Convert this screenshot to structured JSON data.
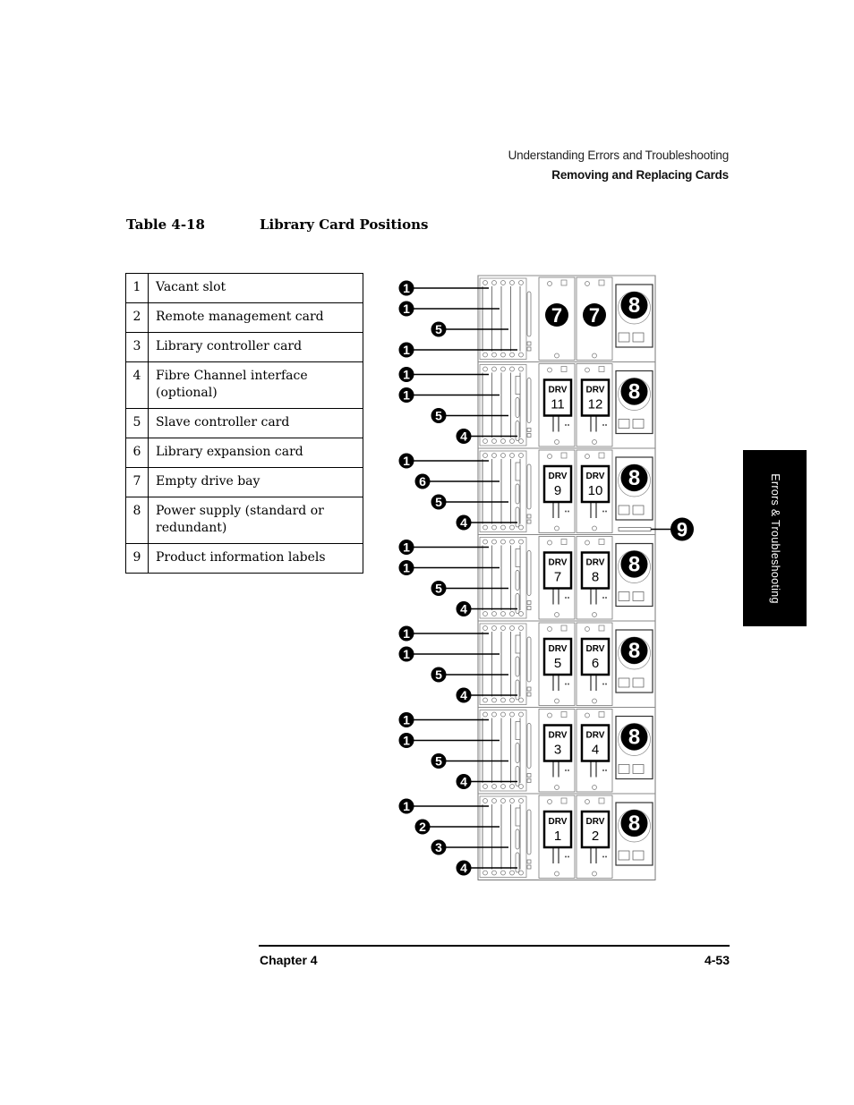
{
  "header": {
    "section": "Understanding Errors and Troubleshooting",
    "subsection": "Removing and Replacing Cards"
  },
  "table": {
    "number": "Table 4-18",
    "title": "Library Card Positions",
    "rows": [
      {
        "num": "1",
        "desc": "Vacant slot"
      },
      {
        "num": "2",
        "desc": "Remote management card"
      },
      {
        "num": "3",
        "desc": "Library controller card"
      },
      {
        "num": "4",
        "desc": "Fibre Channel interface (optional)"
      },
      {
        "num": "5",
        "desc": "Slave controller card"
      },
      {
        "num": "6",
        "desc": "Library expansion card"
      },
      {
        "num": "7",
        "desc": "Empty drive bay"
      },
      {
        "num": "8",
        "desc": "Power supply (standard or redundant)"
      },
      {
        "num": "9",
        "desc": "Product information labels"
      }
    ]
  },
  "diagram": {
    "drive_label": "DRV",
    "modules": [
      {
        "callouts": [
          "1",
          "1",
          "5",
          "1"
        ],
        "drives": [
          "7",
          "7"
        ],
        "drive_type": "empty",
        "power": "8"
      },
      {
        "callouts": [
          "1",
          "1",
          "5",
          "4"
        ],
        "drives": [
          "11",
          "12"
        ],
        "drive_type": "drive",
        "power": "8"
      },
      {
        "callouts": [
          "1",
          "6",
          "5",
          "4"
        ],
        "drives": [
          "9",
          "10"
        ],
        "drive_type": "drive",
        "power": "8"
      },
      {
        "callouts": [
          "1",
          "1",
          "5",
          "4"
        ],
        "drives": [
          "7",
          "8"
        ],
        "drive_type": "drive",
        "power": "8"
      },
      {
        "callouts": [
          "1",
          "1",
          "5",
          "4"
        ],
        "drives": [
          "5",
          "6"
        ],
        "drive_type": "drive",
        "power": "8"
      },
      {
        "callouts": [
          "1",
          "1",
          "5",
          "4"
        ],
        "drives": [
          "3",
          "4"
        ],
        "drive_type": "drive",
        "power": "8"
      },
      {
        "callouts": [
          "1",
          "2",
          "3",
          "4"
        ],
        "drives": [
          "1",
          "2"
        ],
        "drive_type": "drive",
        "power": "8"
      }
    ],
    "label_callout": "9"
  },
  "side_tab": "Errors & Troubleshooting",
  "footer": {
    "chapter": "Chapter 4",
    "page": "4-53"
  }
}
